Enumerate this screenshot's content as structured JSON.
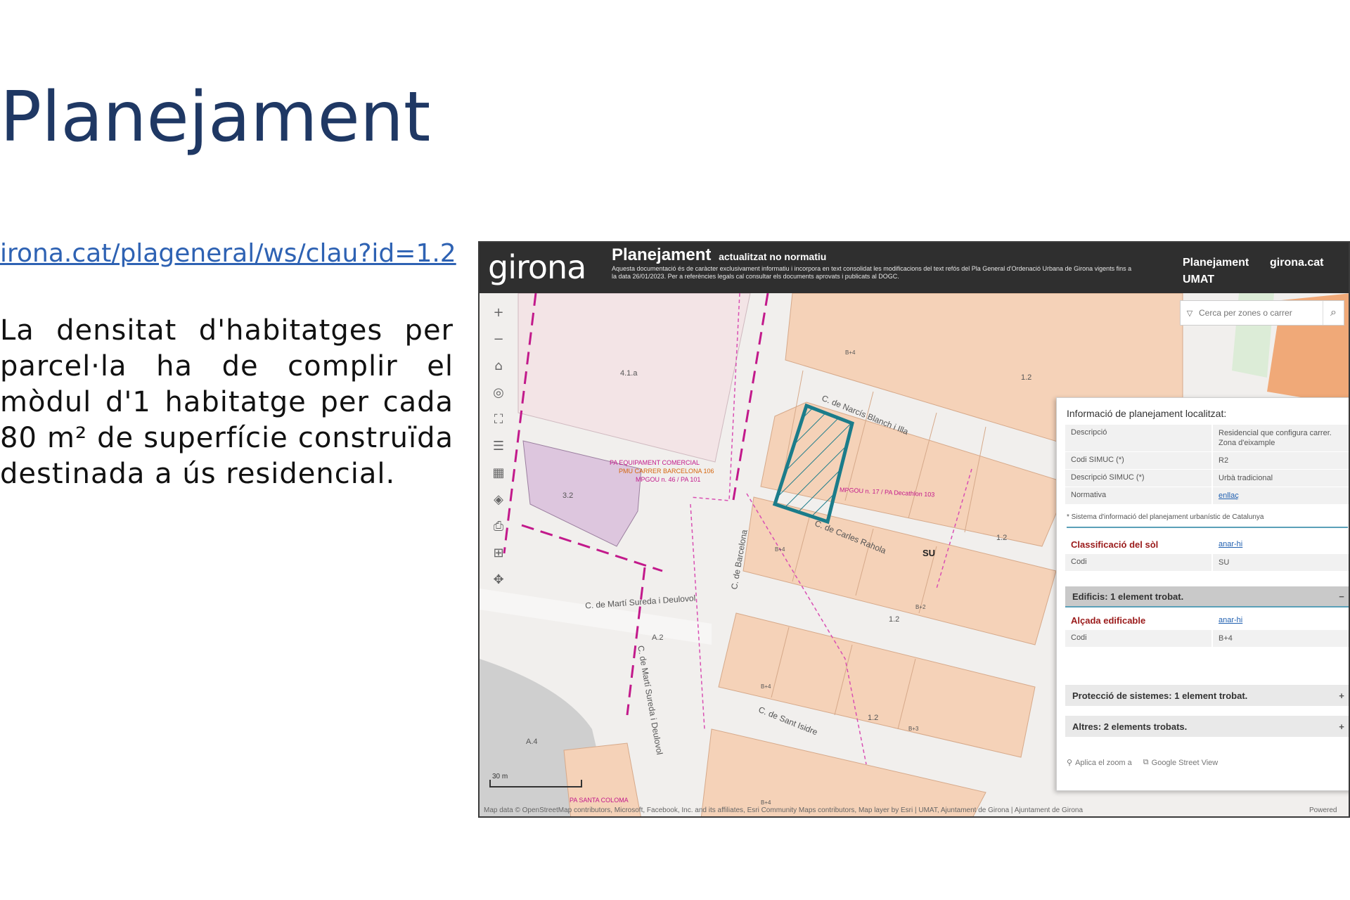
{
  "slide": {
    "title": "Planejament",
    "link": "irona.cat/plageneral/ws/clau?id=1.2",
    "body": "La densitat d'habitatges per parcel·la ha de complir el mòdul d'1 habitatge per cada 80 m² de superfície construïda destinada a ús residencial."
  },
  "app": {
    "logo": "girona",
    "title": "Planejament",
    "subtitle": "actualitzat no normatiu",
    "description": "Aquesta documentació és de caràcter exclusivament informatiu i incorpora en text consolidat les modificacions del text refós del Pla General d'Ordenació Urbana de Girona vigents fins a la data 26/01/2023. Per a referències legals cal consultar els documents aprovats i publicats al DOGC.",
    "nav": {
      "planejament": "Planejament",
      "umat": "UMAT",
      "girona_cat": "girona.cat"
    },
    "search": {
      "placeholder": "Cerca per zones o carrer"
    },
    "toolbar": [
      {
        "icon": "zoom-in-icon",
        "glyph": "+"
      },
      {
        "icon": "zoom-out-icon",
        "glyph": "−"
      },
      {
        "icon": "home-icon",
        "glyph": "⌂"
      },
      {
        "icon": "locate-icon",
        "glyph": "◎"
      },
      {
        "icon": "fullscreen-icon",
        "glyph": "⛶"
      },
      {
        "icon": "list-icon",
        "glyph": "☰"
      },
      {
        "icon": "basemap-icon",
        "glyph": "▦"
      },
      {
        "icon": "layers-icon",
        "glyph": "◈"
      },
      {
        "icon": "print-icon",
        "glyph": "⎙"
      },
      {
        "icon": "measure-icon",
        "glyph": "⊞"
      },
      {
        "icon": "pan-icon",
        "glyph": "✥"
      }
    ],
    "map_labels": {
      "zone_41a": "4.1.a",
      "zone_32": "3.2",
      "zone_12a": "1.2",
      "zone_12b": "1.2",
      "zone_12c": "1.2",
      "zone_12d": "1.2",
      "zone_a2": "A.2",
      "zone_a4": "A.4",
      "su": "SU",
      "street_narcis": "C. de Narcís Blanch i Illa",
      "street_carles": "C. de Carles Rahola",
      "street_barcelona": "C. de Barcelona",
      "street_marti": "C. de Martí Sureda i Deulovol",
      "street_marti_v": "C. de Martí Sureda i Deulovol",
      "street_isidre": "C. de Sant Isidre",
      "pa_equipament": "PA EQUIPAMENT COMERCIAL",
      "pmu_carrer": "PMU CARRER BARCELONA 106",
      "mpgou_46": "MPGOU n. 46 / PA 101",
      "mpgou_17": "MPGOU n. 17 / PA Decathlon 103",
      "pa_santa": "PA SANTA COLOMA",
      "scale": "30 m",
      "b4a": "B+4",
      "b4b": "B+4",
      "b4c": "B+4",
      "b4d": "B+4",
      "b2": "B+2",
      "b3": "B+3"
    },
    "info_panel": {
      "title": "Informació de planejament localitzat:",
      "rows1": [
        {
          "key": "Descripció",
          "value": "Residencial que configura carrer. Zona d'eixample"
        },
        {
          "key": "Codi SIMUC (*)",
          "value": "R2"
        },
        {
          "key": "Descripció SIMUC (*)",
          "value": "Urbà tradicional"
        },
        {
          "key": "Normativa",
          "value": "enllaç"
        }
      ],
      "footnote": "* Sistema d'informació del planejament urbanístic de Catalunya",
      "classificacio": {
        "label": "Classificació del sòl",
        "link": "anar-hi",
        "code_key": "Codi",
        "code_value": "SU"
      },
      "edificis": {
        "label": "Edificis: 1 element trobat.",
        "sign": "−"
      },
      "alcada": {
        "label": "Alçada edificable",
        "link": "anar-hi",
        "code_key": "Codi",
        "code_value": "B+4"
      },
      "proteccio": {
        "label": "Protecció de sistemes: 1 element trobat.",
        "sign": "+"
      },
      "altres": {
        "label": "Altres: 2 elements trobats.",
        "sign": "+"
      },
      "actions": {
        "zoom": "Aplica el zoom a",
        "streetview": "Google Street View"
      }
    },
    "attribution": "Map data © OpenStreetMap contributors, Microsoft, Facebook, Inc. and its affiliates, Esri Community Maps contributors, Map layer by Esri | UMAT, Ajuntament de Girona | Ajuntament de Girona",
    "powered": "Powered"
  },
  "colors": {
    "title": "#1f3864",
    "link": "#2e62b3",
    "header_bg": "#2f2f2f",
    "parcel_fill": "#f5d2b8",
    "equipment_fill": "#f3e4e6",
    "purple_fill": "#ddc6de",
    "boundary_magenta": "#c2198b",
    "highlight_teal": "#1b7c8a"
  }
}
